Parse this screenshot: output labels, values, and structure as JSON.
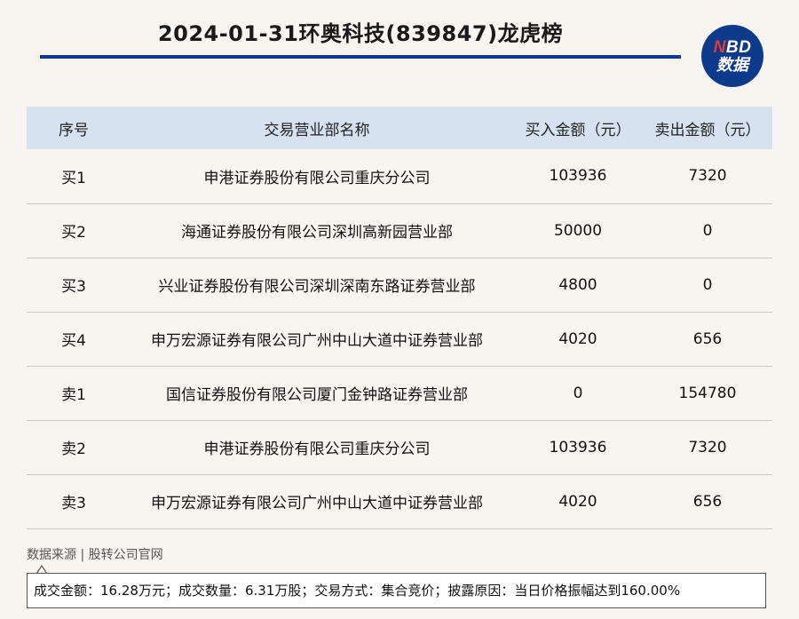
{
  "header": {
    "title": "2024-01-31环奥科技(839847)龙虎榜",
    "logo": {
      "line1_n": "N",
      "line1_rest": "BD",
      "line2": "数据"
    }
  },
  "table": {
    "columns": [
      "序号",
      "交易营业部名称",
      "买入金额（元）",
      "卖出金额（元）"
    ],
    "rows": [
      [
        "买1",
        "申港证券股份有限公司重庆分公司",
        "103936",
        "7320"
      ],
      [
        "买2",
        "海通证券股份有限公司深圳高新园营业部",
        "50000",
        "0"
      ],
      [
        "买3",
        "兴业证券股份有限公司深圳深南东路证券营业部",
        "4800",
        "0"
      ],
      [
        "买4",
        "申万宏源证券有限公司广州中山大道中证券营业部",
        "4020",
        "656"
      ],
      [
        "卖1",
        "国信证券股份有限公司厦门金钟路证券营业部",
        "0",
        "154780"
      ],
      [
        "卖2",
        "申港证券股份有限公司重庆分公司",
        "103936",
        "7320"
      ],
      [
        "卖3",
        "申万宏源证券有限公司广州中山大道中证券营业部",
        "4020",
        "656"
      ]
    ]
  },
  "footer": {
    "source": "数据来源 | 股转公司官网",
    "note": "成交金额：16.28万元；成交数量：6.31万股；交易方式：集合竞价；披露原因：当日价格振幅达到160.00%"
  },
  "colors": {
    "accent": "#0e3a8c",
    "header_bg": "#d6e2ef",
    "logo_n": "#e23b3b"
  }
}
